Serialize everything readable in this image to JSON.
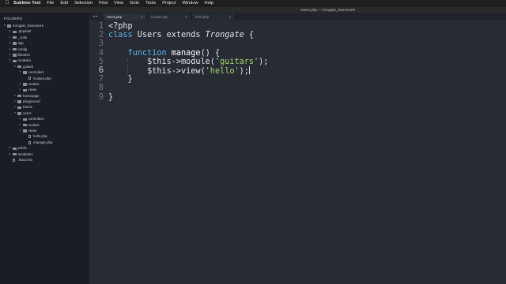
{
  "menubar": {
    "app_name": "Sublime Text",
    "items": [
      "File",
      "Edit",
      "Selection",
      "Find",
      "View",
      "Goto",
      "Tools",
      "Project",
      "Window",
      "Help"
    ]
  },
  "window_title": "Users.php — trongate_framework",
  "sidebar": {
    "heading": "FOLDERS",
    "tree": [
      {
        "label": "trongate_framework",
        "depth": 0,
        "type": "folder",
        "open": true
      },
      {
        "label": ".phpintel",
        "depth": 1,
        "type": "folder",
        "open": false
      },
      {
        "label": "_Junk",
        "depth": 1,
        "type": "folder",
        "open": false
      },
      {
        "label": "app",
        "depth": 1,
        "type": "folder",
        "open": false
      },
      {
        "label": "config",
        "depth": 1,
        "type": "folder",
        "open": false
      },
      {
        "label": "libraries",
        "depth": 1,
        "type": "folder",
        "open": false
      },
      {
        "label": "modules",
        "depth": 1,
        "type": "folder",
        "open": true
      },
      {
        "label": "guitars",
        "depth": 2,
        "type": "folder",
        "open": true
      },
      {
        "label": "controllers",
        "depth": 3,
        "type": "folder",
        "open": true
      },
      {
        "label": "Guitars.php",
        "depth": 4,
        "type": "file"
      },
      {
        "label": "models",
        "depth": 3,
        "type": "folder",
        "open": false
      },
      {
        "label": "views",
        "depth": 3,
        "type": "folder",
        "open": false
      },
      {
        "label": "homepage",
        "depth": 2,
        "type": "folder",
        "open": false
      },
      {
        "label": "playground",
        "depth": 2,
        "type": "folder",
        "open": false
      },
      {
        "label": "teams",
        "depth": 2,
        "type": "folder",
        "open": false
      },
      {
        "label": "users",
        "depth": 2,
        "type": "folder",
        "open": true
      },
      {
        "label": "controllers",
        "depth": 3,
        "type": "folder",
        "open": false
      },
      {
        "label": "models",
        "depth": 3,
        "type": "folder",
        "open": false
      },
      {
        "label": "views",
        "depth": 3,
        "type": "folder",
        "open": true
      },
      {
        "label": "hello.php",
        "depth": 4,
        "type": "file"
      },
      {
        "label": "manage.php",
        "depth": 4,
        "type": "file"
      },
      {
        "label": "public",
        "depth": 1,
        "type": "folder",
        "open": false
      },
      {
        "label": "templates",
        "depth": 1,
        "type": "folder",
        "open": false
      },
      {
        "label": ".htaccess",
        "depth": 1,
        "type": "file"
      }
    ]
  },
  "tabs": [
    {
      "label": "Users.php",
      "active": true
    },
    {
      "label": "Guitars.php",
      "active": false
    },
    {
      "label": "hello.php",
      "active": false
    }
  ],
  "tab_nav": "◂ ▸",
  "tab_close_glyph": "×",
  "editor": {
    "current_line": 6,
    "lines": [
      [
        {
          "t": "<?php",
          "c": "plain"
        }
      ],
      [
        {
          "t": "class",
          "c": "kw"
        },
        {
          "t": " Users ",
          "c": "cls"
        },
        {
          "t": "extends",
          "c": "plain"
        },
        {
          "t": " Trongate",
          "c": "ext"
        },
        {
          "t": " {",
          "c": "plain"
        }
      ],
      [],
      [
        {
          "t": "    ",
          "c": "plain"
        },
        {
          "t": "function",
          "c": "kw"
        },
        {
          "t": " manage",
          "c": "fn"
        },
        {
          "t": "() {",
          "c": "plain"
        }
      ],
      [
        {
          "t": "        $this->module(",
          "c": "plain"
        },
        {
          "t": "'guitars'",
          "c": "str"
        },
        {
          "t": ");",
          "c": "plain"
        }
      ],
      [
        {
          "t": "        $this->view(",
          "c": "plain"
        },
        {
          "t": "'hello'",
          "c": "str"
        },
        {
          "t": ");",
          "c": "plain"
        }
      ],
      [
        {
          "t": "    }",
          "c": "plain"
        }
      ],
      [],
      [
        {
          "t": "}",
          "c": "plain"
        }
      ]
    ]
  }
}
